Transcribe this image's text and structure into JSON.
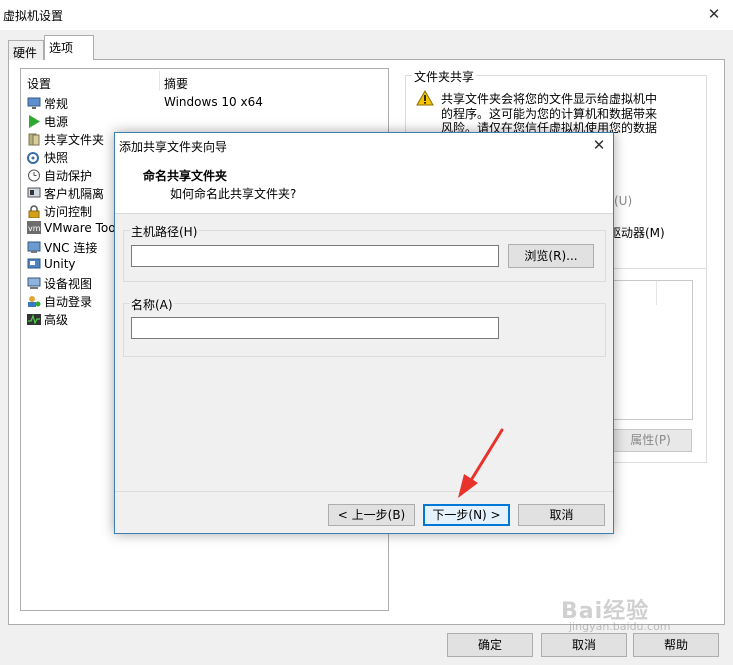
{
  "window": {
    "title": "虚拟机设置",
    "close_glyph": "✕"
  },
  "tabs": [
    {
      "label": "硬件"
    },
    {
      "label": "选项"
    }
  ],
  "settings_list": {
    "col_settings": "设置",
    "col_summary": "摘要",
    "items": [
      {
        "label": "常规",
        "summary": "Windows 10 x64",
        "icon": "monitor-icon"
      },
      {
        "label": "电源",
        "icon": "power-play-icon"
      },
      {
        "label": "共享文件夹",
        "icon": "shared-folder-icon"
      },
      {
        "label": "快照",
        "icon": "snapshot-icon"
      },
      {
        "label": "自动保护",
        "icon": "clock-icon"
      },
      {
        "label": "客户机隔离",
        "icon": "isolation-icon"
      },
      {
        "label": "访问控制",
        "icon": "lock-icon"
      },
      {
        "label": "VMware Too",
        "icon": "vm-logo-icon"
      },
      {
        "label": "VNC 连接",
        "icon": "vnc-icon"
      },
      {
        "label": "Unity",
        "icon": "unity-icon"
      },
      {
        "label": "设备视图",
        "icon": "device-view-icon"
      },
      {
        "label": "自动登录",
        "icon": "auto-login-icon"
      },
      {
        "label": "高级",
        "icon": "advanced-icon"
      }
    ]
  },
  "shared_folders": {
    "group_label": "文件夹共享",
    "warning_lines": [
      "共享文件夹会将您的文件显示给虚拟机中",
      "的程序。这可能为您的计算机和数据带来",
      "风险。请仅在您信任虚拟机使用您的数据"
    ],
    "partial_u": "(U)",
    "partial_drive": "驱动器(M)",
    "properties_label": "属性(P)"
  },
  "footer": {
    "ok": "确定",
    "cancel": "取消",
    "help": "帮助"
  },
  "dialog": {
    "title": "添加共享文件夹向导",
    "close_glyph": "✕",
    "heading": "命名共享文件夹",
    "subheading": "如何命名此共享文件夹?",
    "host_path_label": "主机路径(H)",
    "host_path_value": "",
    "browse_label": "浏览(R)...",
    "name_label": "名称(A)",
    "name_value": "",
    "back_label": "< 上一步(B)",
    "next_label": "下一步(N) >",
    "cancel_label": "取消"
  },
  "watermark": {
    "text": "Bai经验",
    "url": "jingyan.baidu.com"
  },
  "colors": {
    "accent": "#0078d7",
    "arrow": "#e8322c",
    "warning": "#f5c400",
    "power": "#2fa82f"
  }
}
